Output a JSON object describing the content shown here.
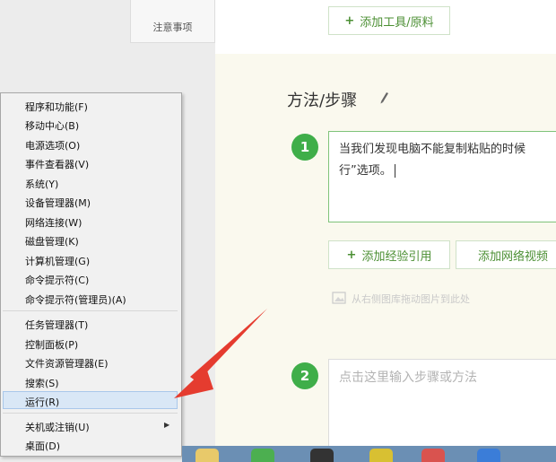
{
  "nav": {
    "tab_label": "注意事项"
  },
  "editor": {
    "add_tool_label": "添加工具/原料",
    "section_title": "方法/步骤",
    "step1": {
      "number": "1",
      "line1": "当我们发现电脑不能复制粘贴的时候",
      "line2": "行”选项。"
    },
    "add_ref_label": "添加经验引用",
    "add_video_label": "添加网络视频",
    "image_hint": "从右侧图库拖动图片到此处",
    "step2": {
      "number": "2",
      "placeholder": "点击这里输入步骤或方法"
    }
  },
  "context_menu": {
    "group1": [
      "程序和功能(F)",
      "移动中心(B)",
      "电源选项(O)",
      "事件查看器(V)",
      "系统(Y)",
      "设备管理器(M)",
      "网络连接(W)",
      "磁盘管理(K)",
      "计算机管理(G)",
      "命令提示符(C)",
      "命令提示符(管理员)(A)"
    ],
    "group2": [
      "任务管理器(T)",
      "控制面板(P)",
      "文件资源管理器(E)",
      "搜索(S)",
      "运行(R)"
    ],
    "group3": [
      "关机或注销(U)",
      "桌面(D)"
    ],
    "highlighted": "运行(R)"
  },
  "colors": {
    "accent_green": "#3fae49",
    "annotation_arrow": "#e53c2f",
    "menu_highlight": "#d9e7f6"
  },
  "icons": [
    "pencil-icon",
    "image-icon",
    "submenu-arrow-icon"
  ]
}
